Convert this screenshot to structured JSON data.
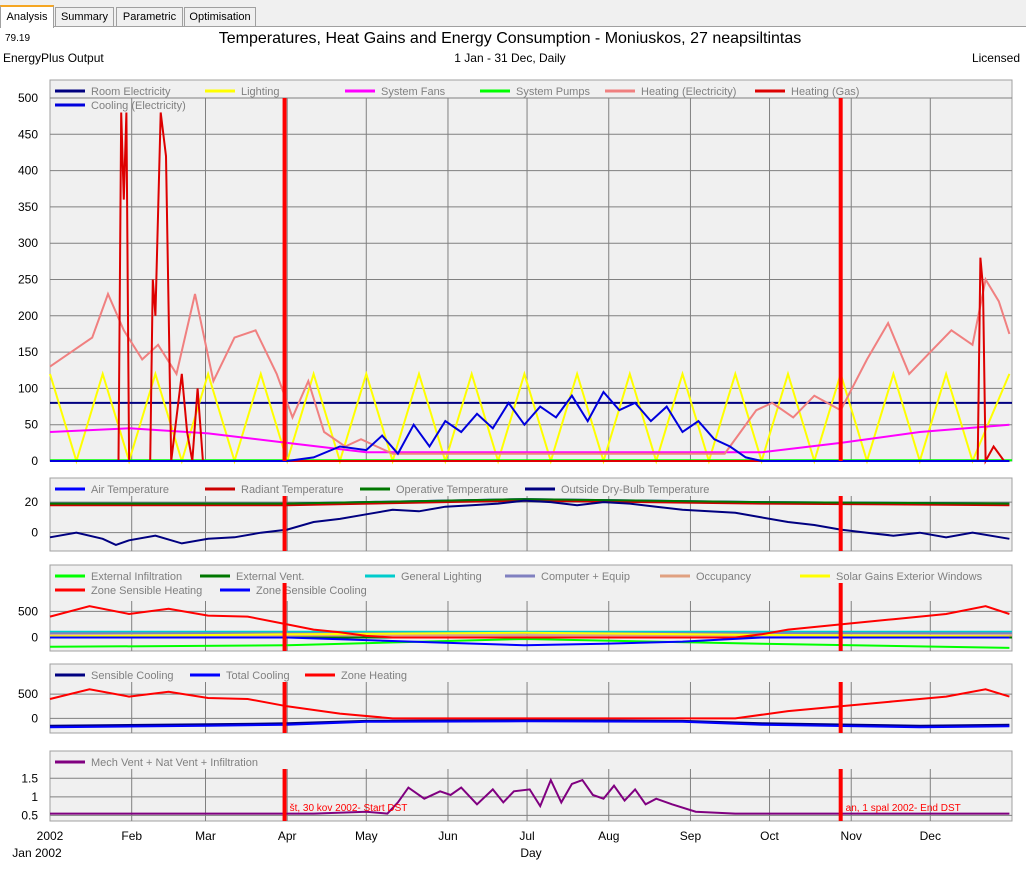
{
  "tabs": [
    {
      "label": "Analysis",
      "active": true
    },
    {
      "label": "Summary",
      "active": false
    },
    {
      "label": "Parametric",
      "active": false
    },
    {
      "label": "Optimisation",
      "active": false
    }
  ],
  "header": {
    "version": "79.19",
    "source": "EnergyPlus Output",
    "title": "Temperatures, Heat Gains and Energy Consumption - Moniuskos, 27 neapsiltintas",
    "subtitle": "1 Jan - 31 Dec, Daily",
    "license": "Licensed"
  },
  "colors": {
    "panel_bg": "#f0f0f0",
    "grid": "#808080",
    "marker": "#ff0000"
  },
  "chart_data": [
    {
      "type": "line",
      "ylim": [
        0,
        500
      ],
      "yticks": [
        0,
        50,
        100,
        150,
        200,
        250,
        300,
        350,
        400,
        450,
        500
      ],
      "series": [
        {
          "name": "Room Electricity",
          "color": "#000080",
          "x": [
            0,
            365
          ],
          "values": [
            80,
            80
          ]
        },
        {
          "name": "Lighting",
          "color": "#ffff00",
          "x": [
            0,
            10,
            20,
            30,
            40,
            50,
            60,
            70,
            80,
            90,
            100,
            110,
            120,
            130,
            140,
            150,
            160,
            170,
            180,
            190,
            200,
            210,
            220,
            230,
            240,
            250,
            260,
            270,
            280,
            290,
            300,
            310,
            320,
            330,
            340,
            350,
            364
          ],
          "values": [
            120,
            0,
            120,
            0,
            120,
            0,
            120,
            0,
            120,
            0,
            120,
            0,
            120,
            0,
            120,
            0,
            120,
            0,
            120,
            0,
            120,
            0,
            120,
            0,
            120,
            0,
            120,
            0,
            120,
            0,
            120,
            0,
            120,
            0,
            120,
            0,
            120
          ]
        },
        {
          "name": "System Fans",
          "color": "#ff00ff",
          "x": [
            0,
            30,
            60,
            90,
            120,
            150,
            180,
            210,
            240,
            270,
            300,
            330,
            364
          ],
          "values": [
            40,
            45,
            38,
            25,
            12,
            12,
            12,
            12,
            12,
            12,
            25,
            40,
            50
          ]
        },
        {
          "name": "System Pumps",
          "color": "#00ff00",
          "x": [
            0,
            365
          ],
          "values": [
            1,
            1
          ]
        },
        {
          "name": "Heating (Electricity)",
          "color": "#f08080",
          "x": [
            0,
            8,
            16,
            22,
            28,
            35,
            41,
            48,
            55,
            62,
            70,
            78,
            86,
            92,
            98,
            104,
            112,
            118,
            124,
            130,
            136,
            142,
            148,
            154,
            160,
            166,
            172,
            178,
            184,
            190,
            196,
            202,
            208,
            214,
            220,
            226,
            232,
            238,
            244,
            250,
            256,
            262,
            268,
            274,
            282,
            290,
            300,
            310,
            318,
            326,
            334,
            342,
            350,
            355,
            360,
            364
          ],
          "values": [
            130,
            150,
            170,
            230,
            180,
            140,
            160,
            120,
            230,
            110,
            170,
            180,
            120,
            60,
            110,
            40,
            20,
            30,
            20,
            10,
            10,
            10,
            10,
            10,
            10,
            10,
            10,
            10,
            10,
            10,
            10,
            10,
            10,
            10,
            10,
            10,
            10,
            10,
            10,
            10,
            10,
            40,
            70,
            80,
            60,
            90,
            70,
            140,
            190,
            120,
            150,
            180,
            160,
            250,
            220,
            175
          ]
        },
        {
          "name": "Heating (Gas)",
          "color": "#dd0000",
          "x": [
            0,
            26,
            27,
            28,
            29,
            30,
            32,
            38,
            39,
            40,
            42,
            44,
            46,
            50,
            52,
            54,
            56,
            58,
            62,
            64,
            66,
            80,
            100,
            140,
            200,
            260,
            280,
            300,
            320,
            340,
            352,
            353,
            354,
            355,
            358,
            362,
            364
          ],
          "values": [
            0,
            0,
            480,
            360,
            480,
            0,
            0,
            0,
            250,
            200,
            480,
            420,
            0,
            120,
            40,
            0,
            100,
            0,
            0,
            0,
            0,
            0,
            0,
            0,
            0,
            0,
            0,
            0,
            0,
            0,
            0,
            280,
            240,
            0,
            20,
            0,
            0
          ]
        },
        {
          "name": "Cooling (Electricity)",
          "color": "#0000dd",
          "x": [
            0,
            90,
            100,
            110,
            120,
            126,
            132,
            138,
            144,
            150,
            156,
            162,
            168,
            174,
            180,
            186,
            192,
            198,
            204,
            210,
            216,
            222,
            228,
            234,
            240,
            246,
            252,
            258,
            264,
            270,
            364
          ],
          "values": [
            0,
            0,
            5,
            20,
            15,
            35,
            10,
            50,
            20,
            55,
            40,
            65,
            45,
            80,
            50,
            75,
            60,
            90,
            55,
            95,
            70,
            80,
            55,
            75,
            40,
            55,
            30,
            20,
            5,
            0,
            0
          ]
        }
      ]
    },
    {
      "type": "line",
      "ylim": [
        -12,
        24
      ],
      "yticks": [
        0,
        20
      ],
      "series": [
        {
          "name": "Air Temperature",
          "color": "#0000ff",
          "x": [
            0,
            90,
            180,
            270,
            364
          ],
          "values": [
            19,
            19,
            22,
            20,
            19
          ]
        },
        {
          "name": "Radiant Temperature",
          "color": "#cc0000",
          "x": [
            0,
            90,
            180,
            270,
            364
          ],
          "values": [
            18,
            18,
            21,
            19,
            18
          ]
        },
        {
          "name": "Operative Temperature",
          "color": "#007700",
          "x": [
            0,
            90,
            180,
            270,
            364
          ],
          "values": [
            19,
            19,
            22,
            20,
            19
          ]
        },
        {
          "name": "Outside Dry-Bulb Temperature",
          "color": "#000080",
          "x": [
            0,
            10,
            20,
            25,
            30,
            40,
            50,
            60,
            70,
            80,
            90,
            100,
            110,
            120,
            130,
            140,
            150,
            160,
            170,
            180,
            190,
            200,
            210,
            220,
            230,
            240,
            250,
            260,
            270,
            280,
            290,
            300,
            310,
            320,
            330,
            340,
            350,
            364
          ],
          "values": [
            -3,
            0,
            -4,
            -8,
            -5,
            -2,
            -7,
            -4,
            -3,
            0,
            2,
            7,
            9,
            12,
            15,
            14,
            17,
            18,
            19,
            21,
            20,
            18,
            20,
            19,
            17,
            15,
            14,
            13,
            10,
            7,
            5,
            2,
            0,
            -2,
            0,
            -3,
            0,
            -4
          ]
        }
      ]
    },
    {
      "type": "line",
      "ylim": [
        -260,
        700
      ],
      "yticks": [
        0,
        500
      ],
      "series": [
        {
          "name": "External Infiltration",
          "color": "#00ff00",
          "x": [
            0,
            90,
            180,
            270,
            364
          ],
          "values": [
            -180,
            -150,
            -30,
            -120,
            -200
          ]
        },
        {
          "name": "External Vent.",
          "color": "#007700",
          "x": [
            0,
            365
          ],
          "values": [
            0,
            0
          ]
        },
        {
          "name": "General Lighting",
          "color": "#00cccc",
          "x": [
            0,
            365
          ],
          "values": [
            110,
            110
          ]
        },
        {
          "name": "Computer + Equip",
          "color": "#8080c0",
          "x": [
            0,
            365
          ],
          "values": [
            80,
            80
          ]
        },
        {
          "name": "Occupancy",
          "color": "#e0a080",
          "x": [
            0,
            365
          ],
          "values": [
            40,
            40
          ]
        },
        {
          "name": "Solar Gains Exterior Windows",
          "color": "#ffff00",
          "x": [
            0,
            90,
            180,
            270,
            364
          ],
          "values": [
            20,
            60,
            90,
            50,
            20
          ]
        },
        {
          "name": "Zone Sensible Heating",
          "color": "#ff0000",
          "x": [
            0,
            15,
            30,
            45,
            60,
            75,
            90,
            100,
            110,
            120,
            130,
            260,
            270,
            280,
            300,
            320,
            340,
            355,
            364
          ],
          "values": [
            400,
            600,
            450,
            550,
            420,
            400,
            250,
            150,
            100,
            30,
            0,
            0,
            60,
            150,
            250,
            350,
            450,
            600,
            450
          ]
        },
        {
          "name": "Zone Sensible Cooling",
          "color": "#0000ff",
          "x": [
            0,
            90,
            120,
            150,
            180,
            210,
            240,
            270,
            364
          ],
          "values": [
            0,
            0,
            -50,
            -100,
            -150,
            -120,
            -80,
            0,
            0
          ]
        }
      ]
    },
    {
      "type": "line",
      "ylim": [
        -300,
        750
      ],
      "yticks": [
        0,
        500
      ],
      "series": [
        {
          "name": "Sensible Cooling",
          "color": "#000080",
          "x": [
            0,
            60,
            90,
            120,
            180,
            240,
            270,
            330,
            364
          ],
          "values": [
            -150,
            -120,
            -100,
            -50,
            -30,
            -50,
            -100,
            -150,
            -130
          ]
        },
        {
          "name": "Total Cooling",
          "color": "#0000ff",
          "x": [
            0,
            60,
            90,
            120,
            180,
            240,
            270,
            330,
            364
          ],
          "values": [
            -180,
            -150,
            -130,
            -70,
            -60,
            -70,
            -130,
            -180,
            -160
          ]
        },
        {
          "name": "Zone Heating",
          "color": "#ff0000",
          "x": [
            0,
            15,
            30,
            45,
            60,
            75,
            90,
            110,
            130,
            260,
            280,
            300,
            320,
            340,
            355,
            364
          ],
          "values": [
            400,
            600,
            450,
            550,
            420,
            400,
            250,
            100,
            0,
            0,
            150,
            250,
            350,
            450,
            600,
            450
          ]
        }
      ]
    },
    {
      "type": "line",
      "ylim": [
        0.35,
        1.75
      ],
      "yticks": [
        0.5,
        1.0,
        1.5
      ],
      "series": [
        {
          "name": "Mech Vent + Nat Vent + Infiltration",
          "color": "#800080",
          "x": [
            0,
            100,
            120,
            128,
            132,
            136,
            142,
            148,
            152,
            156,
            162,
            168,
            172,
            176,
            182,
            186,
            190,
            194,
            198,
            202,
            206,
            210,
            214,
            218,
            222,
            226,
            230,
            236,
            245,
            260,
            364
          ],
          "values": [
            0.55,
            0.55,
            0.6,
            0.55,
            0.85,
            1.25,
            0.95,
            1.15,
            1.05,
            1.25,
            0.8,
            1.2,
            0.85,
            1.15,
            1.2,
            0.75,
            1.45,
            0.85,
            1.35,
            1.45,
            1.05,
            0.95,
            1.3,
            0.9,
            1.2,
            0.8,
            0.95,
            0.8,
            0.6,
            0.55,
            0.55
          ]
        }
      ]
    }
  ],
  "dst_markers": [
    {
      "day": 89,
      "label": "št, 30 kov 2002- Start DST"
    },
    {
      "day": 300,
      "label": "an, 1 spal 2002- End DST"
    }
  ],
  "x_axis": {
    "year_label": "2002",
    "start_label": "Jan 2002",
    "xlabel": "Day",
    "month_labels": [
      "Feb",
      "Mar",
      "Apr",
      "May",
      "Jun",
      "Jul",
      "Aug",
      "Sep",
      "Oct",
      "Nov",
      "Dec"
    ],
    "month_days": [
      31,
      59,
      90,
      120,
      151,
      181,
      212,
      243,
      273,
      304,
      334
    ]
  }
}
